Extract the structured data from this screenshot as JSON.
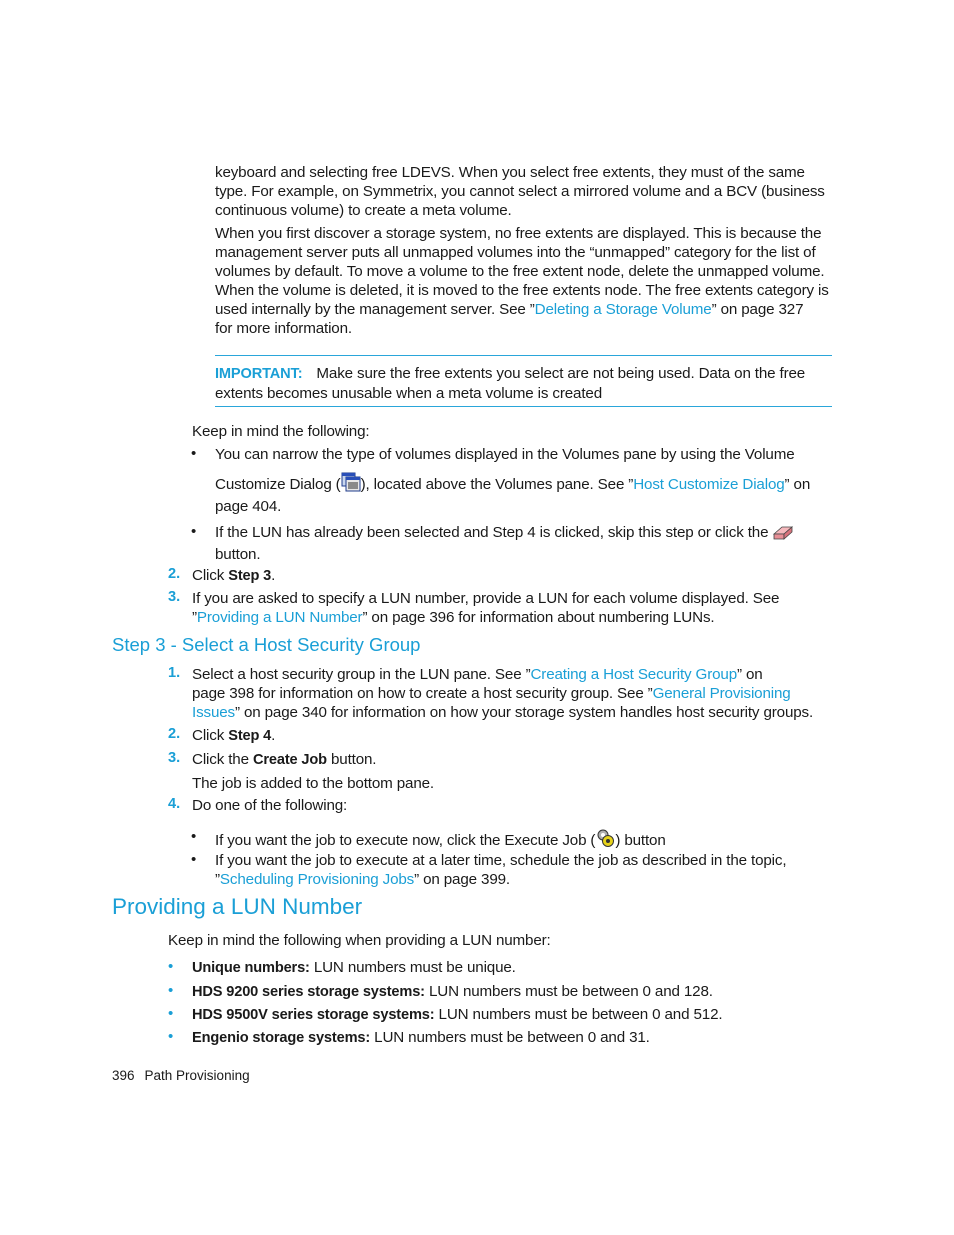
{
  "intro": {
    "para1": {
      "line1": "keyboard and selecting free LDEVS. When you select free extents, they must of the same",
      "line2": "type. For example, on Symmetrix, you cannot select a mirrored volume and a BCV (business",
      "line3": "continuous volume) to create a meta volume."
    },
    "para2": {
      "line1": "When you first discover a storage system, no free extents are displayed. This is because the",
      "line2": "management server puts all unmapped volumes into the “unmapped” category for the list of",
      "line3": "volumes by default. To move a volume to the free extent node, delete the unmapped volume.",
      "line4": "When the volume is deleted, it is moved to the free extents node. The free extents category is",
      "line5_pre": "used internally by the management server. See ”",
      "line5_link": "Deleting a Storage Volume",
      "line5_post": "” on page 327",
      "line6": "for more information."
    }
  },
  "important": {
    "label": "IMPORTANT:",
    "line1": "Make sure the free extents you select are not being used. Data on the free",
    "line2": "extents becomes unusable when a meta volume is created"
  },
  "keep_in_mind": {
    "lead": "Keep in mind the following:",
    "bullet1": {
      "line1": "You can narrow the type of volumes displayed in the Volumes pane by using the Volume",
      "line2_pre": "Customize Dialog (",
      "icon": "customize-dialog-icon",
      "line2_mid": "), located above the Volumes pane. See ”",
      "link": "Host Customize Dialog",
      "line2_post": "” on",
      "line3": "page 404."
    },
    "bullet2": {
      "line1_pre": "If the LUN has already been selected and Step 4 is clicked, skip this step or click the",
      "icon": "eraser-icon",
      "line2": "button."
    }
  },
  "steps_a": [
    {
      "num": "2.",
      "pre": "Click ",
      "bold": "Step 3",
      "post": "."
    },
    {
      "num": "3.",
      "line1": "If you are asked to specify a LUN number, provide a LUN for each volume displayed. See",
      "line2_pre": "”",
      "link": "Providing a LUN Number",
      "line2_post": "” on page 396 for information about numbering LUNs."
    }
  ],
  "section_step3": {
    "heading": "Step 3 - Select a Host Security Group",
    "step1": {
      "num": "1.",
      "line1_pre": "Select a host security group in the LUN pane. See ”",
      "link1": "Creating a Host Security Group",
      "line1_post": "” on",
      "line2_pre": "page 398 for information on how to create a host security group. See ”",
      "link2a": "General Provisioning",
      "link2b": "Issues",
      "line3_post": "” on page 340 for information on how your storage system handles host security groups."
    },
    "step2": {
      "num": "2.",
      "pre": "Click ",
      "bold": "Step 4",
      "post": "."
    },
    "step3": {
      "num": "3.",
      "pre": "Click the ",
      "bold": "Create Job",
      "post": " button.",
      "note": "The job is added to the bottom pane."
    },
    "step4": {
      "num": "4.",
      "text": "Do one of the following:",
      "bullet1_pre": "If you want the job to execute now, click the Execute Job (",
      "bullet1_icon": "execute-job-icon",
      "bullet1_post": ") button",
      "bullet2_line1": "If you want the job to execute at a later time, schedule the job as described in the topic,",
      "bullet2_pre": "”",
      "bullet2_link": "Scheduling Provisioning Jobs",
      "bullet2_post": "” on page 399."
    }
  },
  "section_lun": {
    "heading": "Providing a LUN Number",
    "lead": "Keep in mind the following when providing a LUN number:",
    "items": [
      {
        "bold": "Unique numbers:",
        "text": " LUN numbers must be unique."
      },
      {
        "bold": "HDS 9200 series storage systems:",
        "text": " LUN numbers must be between 0 and 128."
      },
      {
        "bold": "HDS 9500V series storage systems:",
        "text": " LUN numbers must be between 0 and 512."
      },
      {
        "bold": "Engenio storage systems:",
        "text": " LUN numbers must be between 0 and 31."
      }
    ]
  },
  "footer": {
    "page_number": "396",
    "section": "Path Provisioning"
  },
  "colors": {
    "accent": "#1a9fd6",
    "text": "#1a1a1a",
    "rule": "#2aa6da"
  }
}
